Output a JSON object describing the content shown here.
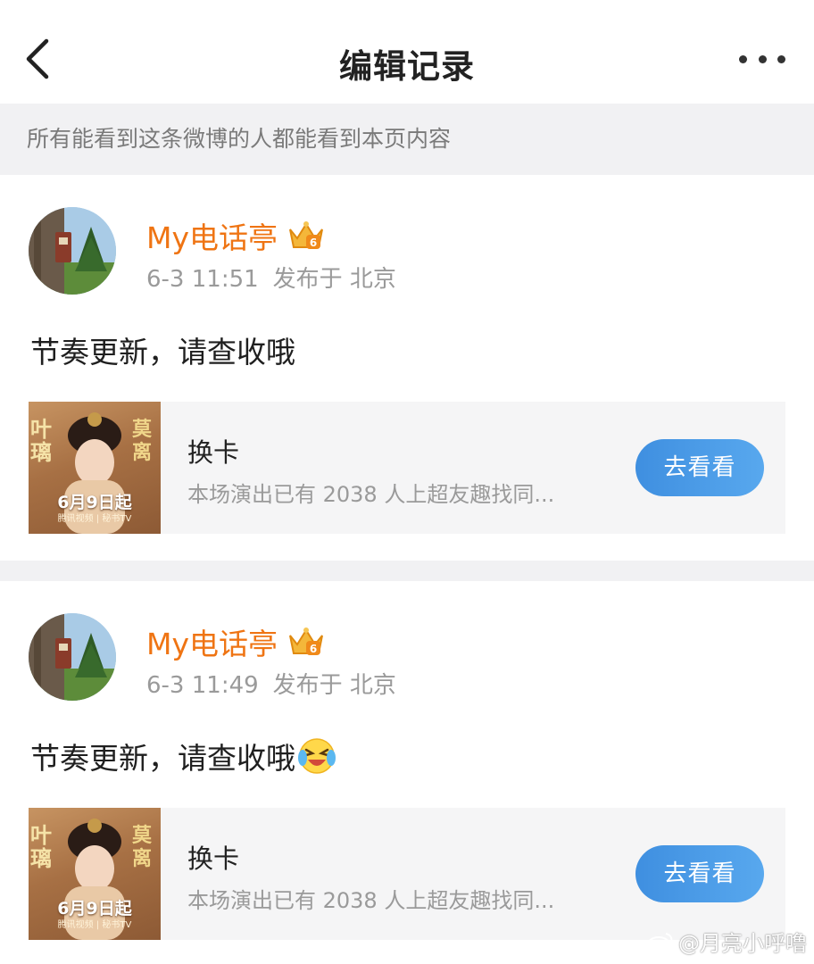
{
  "header": {
    "title": "编辑记录",
    "back_icon": "chevron-left-icon",
    "more_icon": "more-dots-icon"
  },
  "notice": "所有能看到这条微博的人都能看到本页内容",
  "records": [
    {
      "username": "My电话亭",
      "badge_icon": "crown-badge-icon",
      "time": "6-3 11:51",
      "location": "发布于 北京",
      "text": "节奏更新，请查收哦",
      "card": {
        "poster_title": "叶璃",
        "poster_title_2": "莫离",
        "poster_date": "6月9日起",
        "poster_platform": "腾讯视频 | 秘书TV",
        "title": "换卡",
        "desc": "本场演出已有 2038 人上超友趣找同...",
        "button": "去看看"
      }
    },
    {
      "username": "My电话亭",
      "badge_icon": "crown-badge-icon",
      "time": "6-3 11:49",
      "location": "发布于 北京",
      "text": "节奏更新，请查收哦",
      "emoji": "laughing-crying-emoji",
      "card": {
        "poster_title": "叶璃",
        "poster_title_2": "莫离",
        "poster_date": "6月9日起",
        "poster_platform": "腾讯视频 | 秘书TV",
        "title": "换卡",
        "desc": "本场演出已有 2038 人上超友趣找同...",
        "button": "去看看"
      }
    }
  ],
  "watermark": "@月亮小呼噜",
  "colors": {
    "username": "#ef7413",
    "button": "#4a9be6",
    "notice_bg": "#f1f1f3"
  }
}
